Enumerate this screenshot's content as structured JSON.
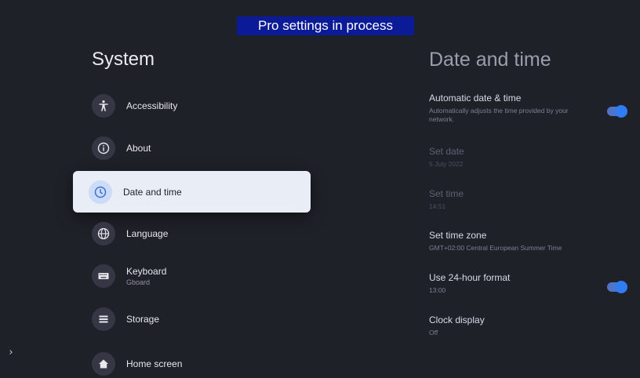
{
  "banner": {
    "text": "Pro settings in process"
  },
  "left_panel": {
    "title": "System",
    "items": [
      {
        "label": "Accessibility",
        "sublabel": "",
        "icon": "accessibility-icon"
      },
      {
        "label": "About",
        "sublabel": "",
        "icon": "info-icon"
      },
      {
        "label": "Date and time",
        "sublabel": "",
        "icon": "clock-icon",
        "selected": true
      },
      {
        "label": "Language",
        "sublabel": "",
        "icon": "globe-icon"
      },
      {
        "label": "Keyboard",
        "sublabel": "Gboard",
        "icon": "keyboard-icon"
      },
      {
        "label": "Storage",
        "sublabel": "",
        "icon": "storage-icon"
      },
      {
        "label": "Home screen",
        "sublabel": "",
        "icon": "home-icon"
      }
    ]
  },
  "right_panel": {
    "title": "Date and time",
    "settings": [
      {
        "title": "Automatic date & time",
        "description": "Automatically adjusts the time provided by your network.",
        "toggle": true,
        "enabled": true
      },
      {
        "title": "Set date",
        "description": "5 July 2022",
        "enabled": false
      },
      {
        "title": "Set time",
        "description": "14:51",
        "enabled": false
      },
      {
        "title": "Set time zone",
        "description": "GMT+02:00 Central European Summer Time",
        "enabled": true
      },
      {
        "title": "Use 24-hour format",
        "description": "13:00",
        "toggle": true,
        "enabled": true
      },
      {
        "title": "Clock display",
        "description": "Off",
        "enabled": true
      }
    ]
  },
  "colors": {
    "background": "#1f2129",
    "accent": "#2f7cf3",
    "banner": "#0b1a96",
    "selected_bg": "#e9edf5"
  },
  "edge_arrow_icon": "chevron-right-icon"
}
